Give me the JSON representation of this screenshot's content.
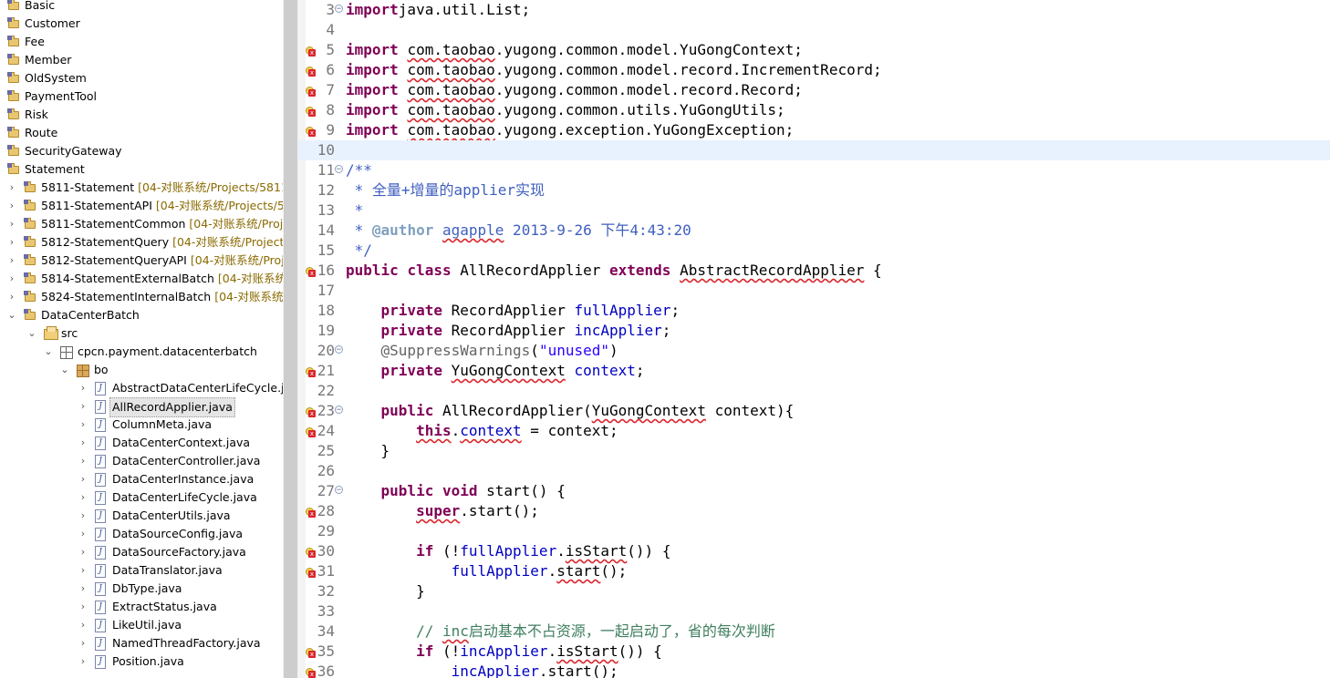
{
  "explorer": {
    "items": [
      {
        "depth": 0,
        "chevron": "",
        "icon": "project-icon",
        "label": "Basic",
        "path": ""
      },
      {
        "depth": 0,
        "chevron": "",
        "icon": "project-icon",
        "label": "Customer",
        "path": ""
      },
      {
        "depth": 0,
        "chevron": "",
        "icon": "project-icon",
        "label": "Fee",
        "path": ""
      },
      {
        "depth": 0,
        "chevron": "",
        "icon": "project-icon",
        "label": "Member",
        "path": ""
      },
      {
        "depth": 0,
        "chevron": "",
        "icon": "project-icon",
        "label": "OldSystem",
        "path": ""
      },
      {
        "depth": 0,
        "chevron": "",
        "icon": "project-icon",
        "label": "PaymentTool",
        "path": ""
      },
      {
        "depth": 0,
        "chevron": "",
        "icon": "project-icon",
        "label": "Risk",
        "path": ""
      },
      {
        "depth": 0,
        "chevron": "",
        "icon": "project-icon",
        "label": "Route",
        "path": ""
      },
      {
        "depth": 0,
        "chevron": "",
        "icon": "project-icon",
        "label": "SecurityGateway",
        "path": ""
      },
      {
        "depth": 0,
        "chevron": "",
        "icon": "project-icon",
        "label": "Statement",
        "path": ""
      },
      {
        "depth": 1,
        "chevron": "›",
        "icon": "project-icon",
        "label": "5811-Statement",
        "path": "[04-对账系统/Projects/5811-S"
      },
      {
        "depth": 1,
        "chevron": "›",
        "icon": "project-icon",
        "label": "5811-StatementAPI",
        "path": "[04-对账系统/Projects/581"
      },
      {
        "depth": 1,
        "chevron": "›",
        "icon": "project-icon",
        "label": "5811-StatementCommon",
        "path": "[04-对账系统/Project"
      },
      {
        "depth": 1,
        "chevron": "›",
        "icon": "project-icon",
        "label": "5812-StatementQuery",
        "path": "[04-对账系统/Projects/5"
      },
      {
        "depth": 1,
        "chevron": "›",
        "icon": "project-icon",
        "label": "5812-StatementQueryAPI",
        "path": "[04-对账系统/Project"
      },
      {
        "depth": 1,
        "chevron": "›",
        "icon": "project-icon",
        "label": "5814-StatementExternalBatch",
        "path": "[04-对账系统/Pr"
      },
      {
        "depth": 1,
        "chevron": "›",
        "icon": "project-icon",
        "label": "5824-StatementInternalBatch",
        "path": "[04-对账系统/Pro"
      },
      {
        "depth": 1,
        "chevron": "⌄",
        "icon": "project-icon",
        "label": "DataCenterBatch",
        "path": ""
      },
      {
        "depth": 2,
        "chevron": "⌄",
        "icon": "source-folder-icon",
        "label": "src",
        "path": ""
      },
      {
        "depth": 3,
        "chevron": "⌄",
        "icon": "package-folder-icon",
        "label": "cpcn.payment.datacenterbatch",
        "path": ""
      },
      {
        "depth": 4,
        "chevron": "⌄",
        "icon": "package-icon",
        "label": "bo",
        "path": ""
      },
      {
        "depth": 5,
        "chevron": "›",
        "icon": "java-file-icon",
        "label": "AbstractDataCenterLifeCycle.java",
        "path": ""
      },
      {
        "depth": 5,
        "chevron": "›",
        "icon": "java-file-icon",
        "label": "AllRecordApplier.java",
        "path": "",
        "selected": true
      },
      {
        "depth": 5,
        "chevron": "›",
        "icon": "java-file-icon",
        "label": "ColumnMeta.java",
        "path": ""
      },
      {
        "depth": 5,
        "chevron": "›",
        "icon": "java-file-icon",
        "label": "DataCenterContext.java",
        "path": ""
      },
      {
        "depth": 5,
        "chevron": "›",
        "icon": "java-file-icon",
        "label": "DataCenterController.java",
        "path": ""
      },
      {
        "depth": 5,
        "chevron": "›",
        "icon": "java-file-icon",
        "label": "DataCenterInstance.java",
        "path": ""
      },
      {
        "depth": 5,
        "chevron": "›",
        "icon": "java-file-icon",
        "label": "DataCenterLifeCycle.java",
        "path": ""
      },
      {
        "depth": 5,
        "chevron": "›",
        "icon": "java-file-icon",
        "label": "DataCenterUtils.java",
        "path": ""
      },
      {
        "depth": 5,
        "chevron": "›",
        "icon": "java-file-icon",
        "label": "DataSourceConfig.java",
        "path": ""
      },
      {
        "depth": 5,
        "chevron": "›",
        "icon": "java-file-icon",
        "label": "DataSourceFactory.java",
        "path": ""
      },
      {
        "depth": 5,
        "chevron": "›",
        "icon": "java-file-icon",
        "label": "DataTranslator.java",
        "path": ""
      },
      {
        "depth": 5,
        "chevron": "›",
        "icon": "java-file-icon",
        "label": "DbType.java",
        "path": ""
      },
      {
        "depth": 5,
        "chevron": "›",
        "icon": "java-file-icon",
        "label": "ExtractStatus.java",
        "path": ""
      },
      {
        "depth": 5,
        "chevron": "›",
        "icon": "java-file-icon",
        "label": "LikeUtil.java",
        "path": ""
      },
      {
        "depth": 5,
        "chevron": "›",
        "icon": "java-file-icon",
        "label": "NamedThreadFactory.java",
        "path": ""
      },
      {
        "depth": 5,
        "chevron": "›",
        "icon": "java-file-icon",
        "label": "Position.java",
        "path": ""
      }
    ]
  },
  "editor": {
    "lines": [
      {
        "n": "3",
        "fold": "collapse",
        "marker": "",
        "tokens": [
          [
            "kw",
            "import"
          ],
          [
            "",
            "java.util.List;"
          ]
        ]
      },
      {
        "n": "4",
        "fold": "",
        "marker": "",
        "tokens": []
      },
      {
        "n": "5",
        "fold": "",
        "marker": "error",
        "tokens": [
          [
            "kw",
            "import"
          ],
          [
            "",
            " "
          ],
          [
            "sq",
            "com.taobao"
          ],
          [
            "",
            ".yugong.common.model.YuGongContext;"
          ]
        ]
      },
      {
        "n": "6",
        "fold": "",
        "marker": "error",
        "tokens": [
          [
            "kw",
            "import"
          ],
          [
            "",
            " "
          ],
          [
            "sq",
            "com.taobao"
          ],
          [
            "",
            ".yugong.common.model.record.IncrementRecord;"
          ]
        ]
      },
      {
        "n": "7",
        "fold": "",
        "marker": "error",
        "tokens": [
          [
            "kw",
            "import"
          ],
          [
            "",
            " "
          ],
          [
            "sq",
            "com.taobao"
          ],
          [
            "",
            ".yugong.common.model.record.Record;"
          ]
        ]
      },
      {
        "n": "8",
        "fold": "",
        "marker": "error",
        "tokens": [
          [
            "kw",
            "import"
          ],
          [
            "",
            " "
          ],
          [
            "sq",
            "com.taobao"
          ],
          [
            "",
            ".yugong.common.utils.YuGongUtils;"
          ]
        ]
      },
      {
        "n": "9",
        "fold": "",
        "marker": "error",
        "tokens": [
          [
            "kw",
            "import"
          ],
          [
            "",
            " "
          ],
          [
            "sq",
            "com.taobao"
          ],
          [
            "",
            ".yugong.exception.YuGongException;"
          ]
        ]
      },
      {
        "n": "10",
        "fold": "",
        "marker": "",
        "current": true,
        "tokens": []
      },
      {
        "n": "11",
        "fold": "collapse",
        "marker": "",
        "tokens": [
          [
            "jd",
            "/**"
          ]
        ]
      },
      {
        "n": "12",
        "fold": "",
        "marker": "",
        "tokens": [
          [
            "jd",
            " * 全量+增量的applier实现"
          ]
        ]
      },
      {
        "n": "13",
        "fold": "",
        "marker": "",
        "tokens": [
          [
            "jd",
            " *"
          ]
        ]
      },
      {
        "n": "14",
        "fold": "",
        "marker": "",
        "tokens": [
          [
            "jd",
            " * "
          ],
          [
            "jdtag",
            "@author"
          ],
          [
            "jd",
            " "
          ],
          [
            "jdsq",
            "agapple"
          ],
          [
            "jd",
            " 2013-9-26 下午4:43:20"
          ]
        ]
      },
      {
        "n": "15",
        "fold": "",
        "marker": "",
        "tokens": [
          [
            "jd",
            " */"
          ]
        ]
      },
      {
        "n": "16",
        "fold": "",
        "marker": "error",
        "tokens": [
          [
            "kw",
            "public"
          ],
          [
            "",
            " "
          ],
          [
            "kw",
            "class"
          ],
          [
            "",
            " AllRecordApplier "
          ],
          [
            "kw",
            "extends"
          ],
          [
            "",
            " "
          ],
          [
            "sq",
            "AbstractRecordApplier"
          ],
          [
            "",
            " {"
          ]
        ]
      },
      {
        "n": "17",
        "fold": "",
        "marker": "",
        "tokens": []
      },
      {
        "n": "18",
        "fold": "",
        "marker": "",
        "tokens": [
          [
            "",
            "    "
          ],
          [
            "kw",
            "private"
          ],
          [
            "",
            " RecordApplier "
          ],
          [
            "fld",
            "fullApplier"
          ],
          [
            "",
            ";"
          ]
        ]
      },
      {
        "n": "19",
        "fold": "",
        "marker": "",
        "tokens": [
          [
            "",
            "    "
          ],
          [
            "kw",
            "private"
          ],
          [
            "",
            " RecordApplier "
          ],
          [
            "fld",
            "incApplier"
          ],
          [
            "",
            ";"
          ]
        ]
      },
      {
        "n": "20",
        "fold": "collapse",
        "marker": "",
        "tokens": [
          [
            "",
            "    "
          ],
          [
            "ann",
            "@SuppressWarnings"
          ],
          [
            "",
            "("
          ],
          [
            "str",
            "\"unused\""
          ],
          [
            "",
            ")"
          ]
        ]
      },
      {
        "n": "21",
        "fold": "",
        "marker": "error",
        "tokens": [
          [
            "",
            "    "
          ],
          [
            "kw",
            "private"
          ],
          [
            "",
            " "
          ],
          [
            "sq",
            "YuGongContext"
          ],
          [
            "",
            " "
          ],
          [
            "fld",
            "context"
          ],
          [
            "",
            ";"
          ]
        ]
      },
      {
        "n": "22",
        "fold": "",
        "marker": "",
        "tokens": []
      },
      {
        "n": "23",
        "fold": "collapse",
        "marker": "error",
        "tokens": [
          [
            "",
            "    "
          ],
          [
            "kw",
            "public"
          ],
          [
            "",
            " AllRecordApplier("
          ],
          [
            "sq",
            "YuGongContext"
          ],
          [
            "",
            " context){"
          ]
        ]
      },
      {
        "n": "24",
        "fold": "",
        "marker": "error",
        "tokens": [
          [
            "",
            "        "
          ],
          [
            "kwsq",
            "this"
          ],
          [
            "",
            "."
          ],
          [
            "fldsq",
            "context"
          ],
          [
            "",
            " = context;"
          ]
        ]
      },
      {
        "n": "25",
        "fold": "",
        "marker": "",
        "tokens": [
          [
            "",
            "    }"
          ]
        ]
      },
      {
        "n": "26",
        "fold": "",
        "marker": "",
        "tokens": []
      },
      {
        "n": "27",
        "fold": "collapse",
        "marker": "",
        "tokens": [
          [
            "",
            "    "
          ],
          [
            "kw",
            "public"
          ],
          [
            "",
            " "
          ],
          [
            "kw",
            "void"
          ],
          [
            "",
            " start() {"
          ]
        ]
      },
      {
        "n": "28",
        "fold": "",
        "marker": "error",
        "tokens": [
          [
            "",
            "        "
          ],
          [
            "kwsq",
            "super"
          ],
          [
            "",
            ".start();"
          ]
        ]
      },
      {
        "n": "29",
        "fold": "",
        "marker": "",
        "tokens": []
      },
      {
        "n": "30",
        "fold": "",
        "marker": "error",
        "tokens": [
          [
            "",
            "        "
          ],
          [
            "kw",
            "if"
          ],
          [
            "",
            " (!"
          ],
          [
            "fld",
            "fullApplier"
          ],
          [
            "",
            "."
          ],
          [
            "sq",
            "isStart"
          ],
          [
            "",
            "()) {"
          ]
        ]
      },
      {
        "n": "31",
        "fold": "",
        "marker": "error",
        "tokens": [
          [
            "",
            "            "
          ],
          [
            "fld",
            "fullApplier"
          ],
          [
            "",
            "."
          ],
          [
            "sq",
            "start"
          ],
          [
            "",
            "();"
          ]
        ]
      },
      {
        "n": "32",
        "fold": "",
        "marker": "",
        "tokens": [
          [
            "",
            "        }"
          ]
        ]
      },
      {
        "n": "33",
        "fold": "",
        "marker": "",
        "tokens": []
      },
      {
        "n": "34",
        "fold": "",
        "marker": "",
        "tokens": [
          [
            "",
            "        "
          ],
          [
            "cmt",
            "// "
          ],
          [
            "cmtsq",
            "inc"
          ],
          [
            "cmt",
            "启动基本不占资源，一起启动了，省的每次判断"
          ]
        ]
      },
      {
        "n": "35",
        "fold": "",
        "marker": "error",
        "tokens": [
          [
            "",
            "        "
          ],
          [
            "kw",
            "if"
          ],
          [
            "",
            " (!"
          ],
          [
            "fld",
            "incApplier"
          ],
          [
            "",
            "."
          ],
          [
            "sq",
            "isStart"
          ],
          [
            "",
            "()) {"
          ]
        ]
      },
      {
        "n": "36",
        "fold": "",
        "marker": "error",
        "tokens": [
          [
            "",
            "            "
          ],
          [
            "fld",
            "incApplier"
          ],
          [
            "",
            "."
          ],
          [
            "sq",
            "start"
          ],
          [
            "",
            "();"
          ]
        ]
      }
    ]
  }
}
